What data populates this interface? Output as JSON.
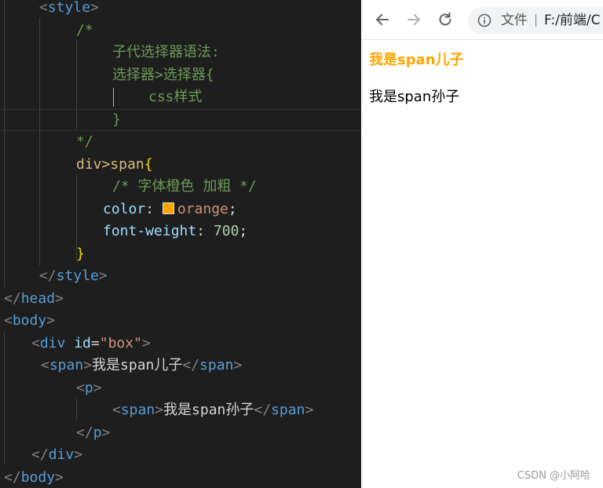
{
  "editor": {
    "lines": [
      {
        "tokens": [
          {
            "t": "<",
            "c": "t-punct"
          },
          {
            "t": "style",
            "c": "t-tag"
          },
          {
            "t": ">",
            "c": "t-punct"
          }
        ]
      },
      {
        "tokens": [
          {
            "t": "/*",
            "c": "t-comment"
          }
        ]
      },
      {
        "tokens": [
          {
            "t": "子代选择器语法:",
            "c": "t-comment"
          }
        ]
      },
      {
        "tokens": [
          {
            "t": "选择器>选择器{",
            "c": "t-comment"
          }
        ]
      },
      {
        "tokens": [
          {
            "t": "css样式",
            "c": "t-comment"
          }
        ]
      },
      {
        "tokens": [
          {
            "t": "}",
            "c": "t-comment"
          }
        ]
      },
      {
        "tokens": [
          {
            "t": "*/",
            "c": "t-comment"
          }
        ]
      },
      {
        "tokens": [
          {
            "t": "div>span",
            "c": "t-sel"
          },
          {
            "t": "{",
            "c": "t-brace"
          }
        ]
      },
      {
        "tokens": [
          {
            "t": "/* 字体橙色 加粗 */",
            "c": "t-comment"
          }
        ]
      },
      {
        "tokens": [
          {
            "t": "color",
            "c": "t-prop"
          },
          {
            "t": ": ",
            "c": "t-text"
          },
          {
            "t": "",
            "c": "swatch"
          },
          {
            "t": "orange",
            "c": "t-val"
          },
          {
            "t": ";",
            "c": "t-text"
          }
        ]
      },
      {
        "tokens": [
          {
            "t": "font-weight",
            "c": "t-prop"
          },
          {
            "t": ": ",
            "c": "t-text"
          },
          {
            "t": "700",
            "c": "t-num"
          },
          {
            "t": ";",
            "c": "t-text"
          }
        ]
      },
      {
        "tokens": [
          {
            "t": "}",
            "c": "t-brace"
          }
        ]
      },
      {
        "tokens": [
          {
            "t": "</",
            "c": "t-punct"
          },
          {
            "t": "style",
            "c": "t-tag"
          },
          {
            "t": ">",
            "c": "t-punct"
          }
        ]
      },
      {
        "tokens": [
          {
            "t": "</",
            "c": "t-punct"
          },
          {
            "t": "head",
            "c": "t-tag"
          },
          {
            "t": ">",
            "c": "t-punct"
          }
        ]
      },
      {
        "tokens": [
          {
            "t": "<",
            "c": "t-punct"
          },
          {
            "t": "body",
            "c": "t-tag"
          },
          {
            "t": ">",
            "c": "t-punct"
          }
        ]
      },
      {
        "tokens": [
          {
            "t": "<",
            "c": "t-punct"
          },
          {
            "t": "div",
            "c": "t-tag"
          },
          {
            "t": " ",
            "c": "t-text"
          },
          {
            "t": "id",
            "c": "t-attr"
          },
          {
            "t": "=",
            "c": "t-text"
          },
          {
            "t": "\"box\"",
            "c": "t-str"
          },
          {
            "t": ">",
            "c": "t-punct"
          }
        ]
      },
      {
        "tokens": [
          {
            "t": "<",
            "c": "t-punct"
          },
          {
            "t": "span",
            "c": "t-tag"
          },
          {
            "t": ">",
            "c": "t-punct"
          },
          {
            "t": "我是span儿子",
            "c": "t-text"
          },
          {
            "t": "</",
            "c": "t-punct"
          },
          {
            "t": "span",
            "c": "t-tag"
          },
          {
            "t": ">",
            "c": "t-punct"
          }
        ]
      },
      {
        "tokens": [
          {
            "t": "<",
            "c": "t-punct"
          },
          {
            "t": "p",
            "c": "t-tag"
          },
          {
            "t": ">",
            "c": "t-punct"
          }
        ]
      },
      {
        "tokens": [
          {
            "t": "<",
            "c": "t-punct"
          },
          {
            "t": "span",
            "c": "t-tag"
          },
          {
            "t": ">",
            "c": "t-punct"
          },
          {
            "t": "我是span孙子",
            "c": "t-text"
          },
          {
            "t": "</",
            "c": "t-punct"
          },
          {
            "t": "span",
            "c": "t-tag"
          },
          {
            "t": ">",
            "c": "t-punct"
          }
        ]
      },
      {
        "tokens": [
          {
            "t": "</",
            "c": "t-punct"
          },
          {
            "t": "p",
            "c": "t-tag"
          },
          {
            "t": ">",
            "c": "t-punct"
          }
        ]
      },
      {
        "tokens": [
          {
            "t": "</",
            "c": "t-punct"
          },
          {
            "t": "div",
            "c": "t-tag"
          },
          {
            "t": ">",
            "c": "t-punct"
          }
        ]
      },
      {
        "tokens": [
          {
            "t": "</",
            "c": "t-punct"
          },
          {
            "t": "body",
            "c": "t-tag"
          },
          {
            "t": ">",
            "c": "t-punct"
          }
        ]
      }
    ]
  },
  "browser": {
    "omnibox_label": "文件",
    "url": "F:/前端/C",
    "icons": {
      "back": "back-arrow-icon",
      "forward": "forward-arrow-icon",
      "reload": "reload-icon",
      "info": "info-icon"
    },
    "page": {
      "son_text": "我是span儿子",
      "grandson_text": "我是span孙子",
      "son_color": "#ffa500"
    },
    "watermark": "CSDN @小阿哈"
  }
}
